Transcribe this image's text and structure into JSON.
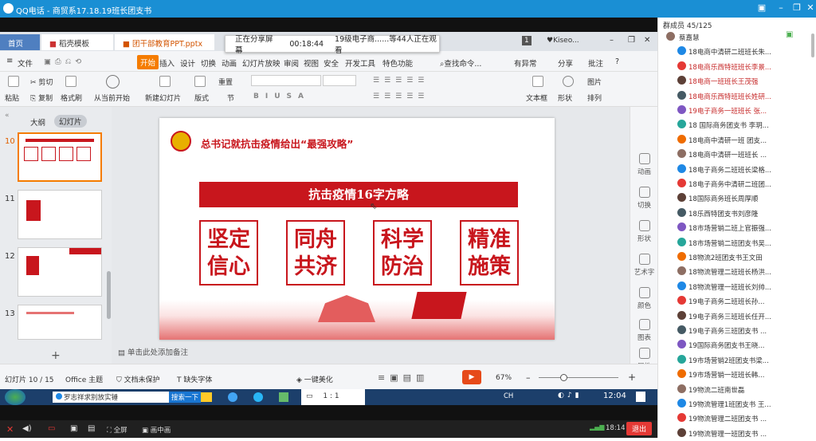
{
  "qq": {
    "title": "QQ电话 - 商贸系17.18.19班长团支书"
  },
  "share": {
    "status": "正在分享屏幕",
    "time": "00:18:44",
    "viewers": "19级电子商......等44人正在观看"
  },
  "wps": {
    "tabs": {
      "home": "首页",
      "tpl": "稻壳模板",
      "file": "团干部教育PPT.pptx"
    },
    "user": "♥Kiseo...",
    "menu": [
      "文件",
      "开始",
      "插入",
      "设计",
      "切换",
      "动画",
      "幻灯片放映",
      "审阅",
      "视图",
      "安全",
      "开发工具",
      "特色功能"
    ],
    "search": "查找命令...",
    "right_menu": [
      "有异常",
      "分享",
      "批注"
    ],
    "tools": {
      "paste": "粘贴",
      "cut": "剪切",
      "copy": "复制",
      "fmt": "格式刷",
      "play": "从当前开始",
      "new_slide": "新建幻灯片",
      "layout": "版式",
      "section": "节",
      "reset": "重置",
      "textbox": "文本框",
      "shape": "形状",
      "image": "图片",
      "arrange": "排列"
    },
    "left": {
      "outline": "大纲",
      "slides": "幻灯片"
    },
    "slide_nums": [
      "10",
      "11",
      "12",
      "13"
    ],
    "slide": {
      "title": "总书记就抗击疫情给出“最强攻略”",
      "banner": "抗击疫情16字方略",
      "boxes": [
        [
          "坚定",
          "信心"
        ],
        [
          "同舟",
          "共济"
        ],
        [
          "科学",
          "防治"
        ],
        [
          "精准",
          "施策"
        ]
      ]
    },
    "notes": "单击此处添加备注",
    "right_panel": [
      "动画",
      "切换",
      "形状",
      "艺术字",
      "颜色",
      "图表",
      "属性"
    ],
    "status": {
      "page": "幻灯片 10 / 15",
      "theme": "Office 主题",
      "protect": "文档未保护",
      "font": "缺失字体",
      "beautify": "一键美化",
      "zoom": "67%"
    }
  },
  "taskbar": {
    "ie": "罗志祥求别放实锤",
    "search": "搜索一下",
    "ratio": "1 : 1",
    "ime": "CH",
    "time": "12:04"
  },
  "bottom": {
    "fullscreen": "全屏",
    "pip": "画中画",
    "time": "18:14",
    "exit": "退出"
  },
  "members": {
    "header": "群成员 45/125",
    "list": [
      "蔡嘉慧",
      "18电商中清研二班班长朱...",
      "18电商乐西特班班长李景...",
      "18电商一班班长王茂强",
      "18电商乐西特班班长姓研...",
      "19电子商务一班班长 张...",
      "18 国际商务团支书 李玥...",
      "18电商中清研一班 团支...",
      "18电商中清研一班班长 ...",
      "18电子商务二班班长梁格...",
      "18电子商务中清研二班团...",
      "18国际商务班长周厚顺",
      "18乐西特团支书刘彦隆",
      "18市场营销二班上官振强...",
      "18市场营销二班团支书吴...",
      "18物流2班团支书王文田",
      "18物流管理二班班长杨洪...",
      "18物流管理一班班长刘帅...",
      "19电子商务二班班长孙...",
      "19电子商务三班班长任开...",
      "19电子商务三班团支书 ...",
      "19国际商务团支书王晓...",
      "19市场营销2班团支书梁...",
      "19市场营销一班班长韩...",
      "19物流二班南世磊",
      "19物流管理1班团支书 王...",
      "19物流管理二班团支书 ...",
      "19物流管理一班团支书 ..."
    ]
  }
}
